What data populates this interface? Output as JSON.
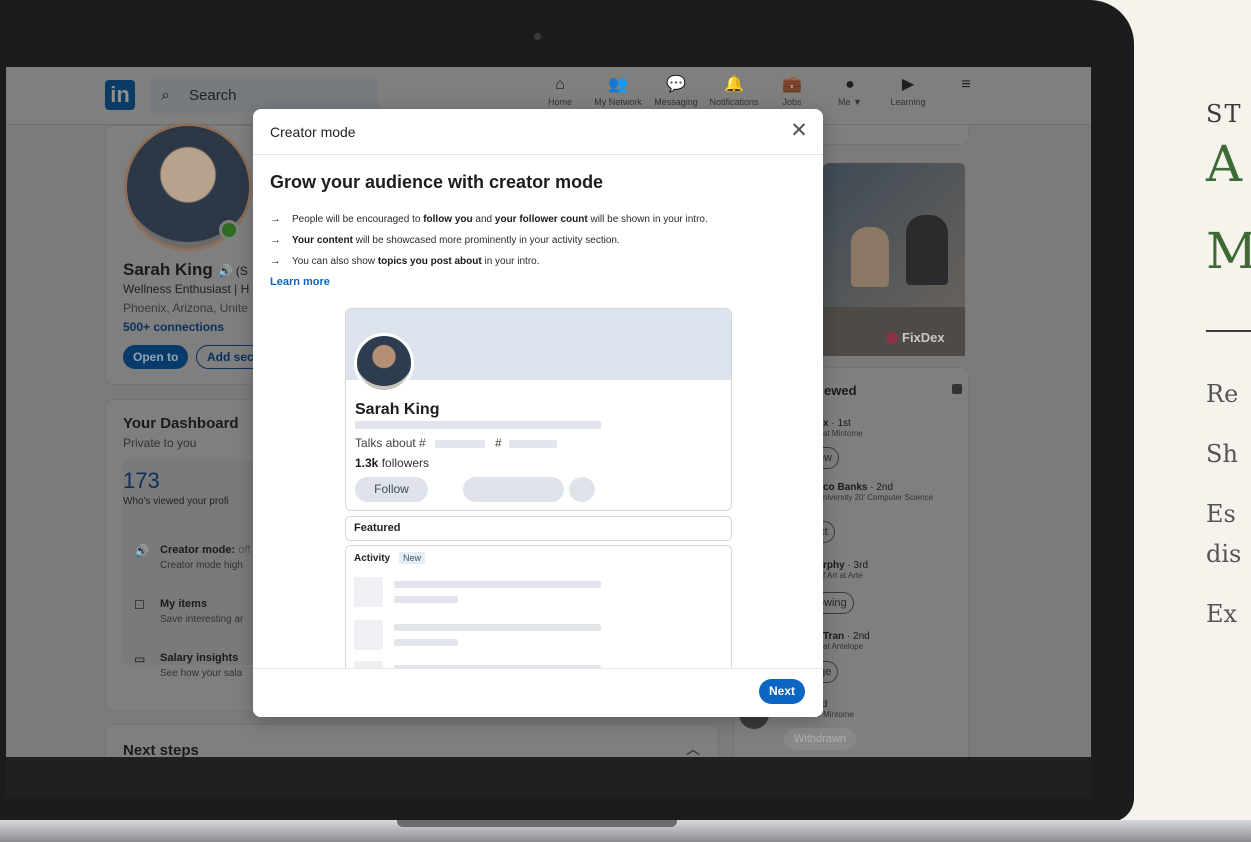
{
  "linkedin": {
    "search_placeholder": "Search",
    "nav": [
      {
        "icon": "home-icon",
        "glyph": "⌂",
        "label": "Home"
      },
      {
        "icon": "network-icon",
        "glyph": "👥",
        "label": "My Network"
      },
      {
        "icon": "messaging-icon",
        "glyph": "💬",
        "label": "Messaging"
      },
      {
        "icon": "bell-icon",
        "glyph": "🔔",
        "label": "Notifications"
      },
      {
        "icon": "briefcase-icon",
        "glyph": "💼",
        "label": "Jobs"
      },
      {
        "icon": "avatar-icon",
        "glyph": "●",
        "label": "Me ▼"
      },
      {
        "icon": "learning-icon",
        "glyph": "▶",
        "label": "Learning"
      }
    ],
    "profile": {
      "name": "Sarah King",
      "name_suffix": "🔊 (S",
      "headline": "Wellness Enthusiast | H",
      "location": "Phoenix, Arizona, Unite",
      "connections": "500+ connections",
      "open_to": "Open to",
      "add_section": "Add sec"
    },
    "dashboard": {
      "title": "Your Dashboard",
      "subtitle": "Private to you",
      "views": "173",
      "views_label": "Who's viewed your profi",
      "rows": [
        {
          "title": "Creator mode:",
          "title_suffix": " off",
          "sub": "Creator mode high"
        },
        {
          "title": "My items",
          "title_suffix": "",
          "sub": "Save interesting ar"
        },
        {
          "title": "Salary insights",
          "title_suffix": "",
          "sub": "See how your sala"
        }
      ]
    },
    "next_steps": "Next steps",
    "ad_brand": "FixDex",
    "viewed_title": "ewed",
    "viewed": [
      {
        "name": "x",
        "degree": " · 1st",
        "role": "at Mintome",
        "button": "llow"
      },
      {
        "name": "co Banks",
        "degree": " · 2nd",
        "role": "niversity 20' Computer Science",
        "button": "ect"
      },
      {
        "name": "rphy",
        "degree": " · 3rd",
        "role": "f Art at Arte",
        "button": "llowing"
      },
      {
        "name": "Tran",
        "degree": " · 2nd",
        "role": "at Antelope",
        "button": "age"
      },
      {
        "name": "olfe",
        "degree": " · 2nd",
        "role": "Director at Mintome",
        "button": "Withdrawn"
      }
    ]
  },
  "modal": {
    "title": "Creator mode",
    "heading": "Grow your audience with creator mode",
    "bullets": [
      {
        "pre": "People will be encouraged to ",
        "b1": "follow you",
        "mid": " and ",
        "b2": "your follower count",
        "post": " will be shown in your intro."
      },
      {
        "pre": "",
        "b1": "Your content",
        "mid": " will be showcased more prominently in your activity section.",
        "b2": "",
        "post": ""
      },
      {
        "pre": "You can also show ",
        "b1": "topics you post about",
        "mid": " in your intro.",
        "b2": "",
        "post": ""
      }
    ],
    "learn_more": "Learn more",
    "preview": {
      "name": "Sarah King",
      "talks_about": "Talks about  #",
      "hash": "#",
      "followers_count": "1.3k",
      "followers_label": " followers",
      "follow_button": "Follow",
      "featured": "Featured",
      "activity": "Activity",
      "new_badge": "New"
    },
    "next_button": "Next"
  },
  "right_panel": {
    "eyebrow": "ST",
    "title_line1": "A",
    "title_line2": "M",
    "lines": [
      "Re",
      "Sh",
      "Es",
      "dis",
      "Ex"
    ]
  }
}
